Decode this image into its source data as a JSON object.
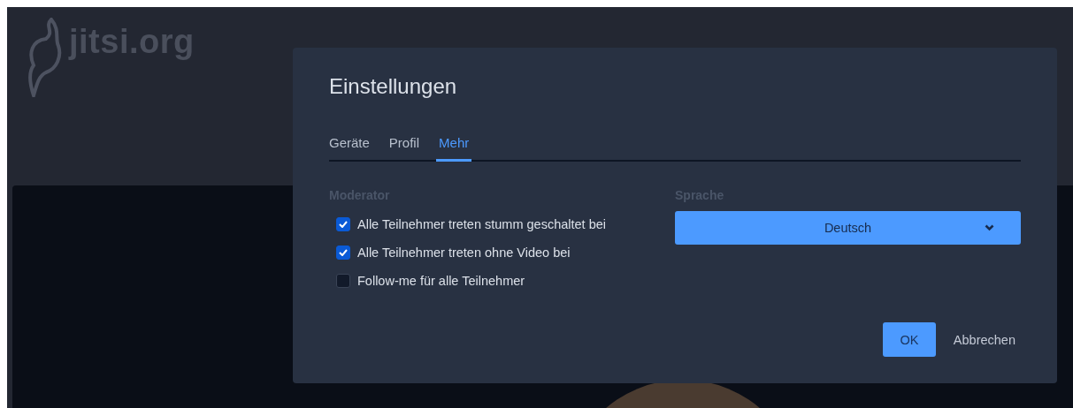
{
  "logo": {
    "text": "jitsi.org"
  },
  "dialog": {
    "title": "Einstellungen",
    "tabs": [
      {
        "label": "Geräte",
        "selected": false
      },
      {
        "label": "Profil",
        "selected": false
      },
      {
        "label": "Mehr",
        "selected": true
      }
    ],
    "moderator": {
      "heading": "Moderator",
      "options": [
        {
          "label": "Alle Teilnehmer treten stumm geschaltet bei",
          "checked": true
        },
        {
          "label": "Alle Teilnehmer treten ohne Video bei",
          "checked": true
        },
        {
          "label": "Follow-me für alle Teilnehmer",
          "checked": false
        }
      ]
    },
    "language": {
      "heading": "Sprache",
      "value": "Deutsch"
    },
    "buttons": [
      {
        "label": "OK",
        "kind": "primary"
      },
      {
        "label": "Abbrechen",
        "kind": "secondary"
      }
    ]
  }
}
